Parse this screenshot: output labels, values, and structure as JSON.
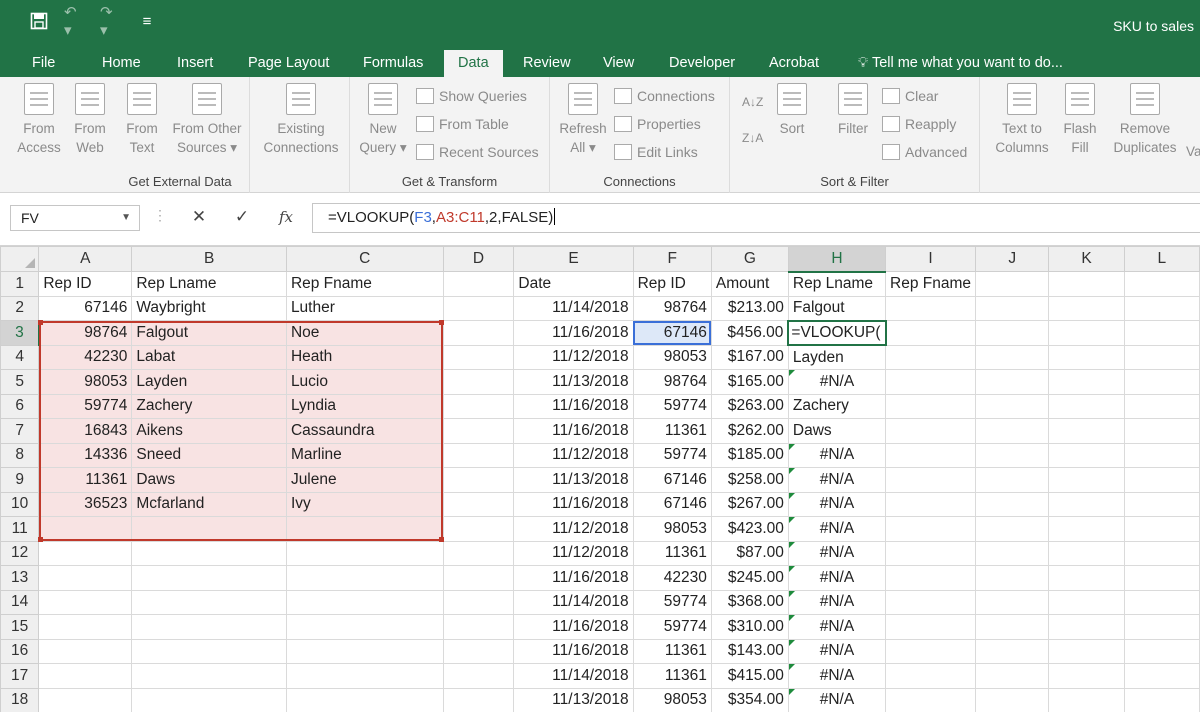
{
  "window": {
    "title": "SKU to sales",
    "qat": [
      "save-icon",
      "undo-icon",
      "redo-icon",
      "customize-icon"
    ]
  },
  "menu": {
    "tabs": [
      "File",
      "Home",
      "Insert",
      "Page Layout",
      "Formulas",
      "Data",
      "Review",
      "View",
      "Developer",
      "Acrobat"
    ],
    "active": "Data",
    "tell_me": "Tell me what you want to do..."
  },
  "ribbon": {
    "get_external": {
      "label": "Get External Data",
      "buttons": [
        "From\nAccess",
        "From\nWeb",
        "From\nText",
        "From Other\nSources ▾",
        "Existing\nConnections"
      ]
    },
    "transform": {
      "label": "Get & Transform",
      "new_query": "New\nQuery ▾",
      "items": [
        "Show Queries",
        "From Table",
        "Recent Sources"
      ]
    },
    "connections": {
      "label": "Connections",
      "refresh": "Refresh\nAll ▾",
      "items": [
        "Connections",
        "Properties",
        "Edit Links"
      ]
    },
    "sort_filter": {
      "label": "Sort & Filter",
      "sort": "Sort",
      "filter": "Filter",
      "items": [
        "Clear",
        "Reapply",
        "Advanced"
      ]
    },
    "data_tools": {
      "buttons": [
        "Text to\nColumns",
        "Flash\nFill",
        "Remove\nDuplicates",
        "Va"
      ]
    }
  },
  "formula_bar": {
    "name_box": "FV",
    "formula_prefix": "=VLOOKUP(",
    "formula_ref1": "F3",
    "formula_sep": ",",
    "formula_ref2": "A3:C11",
    "formula_suffix": ",2,FALSE)"
  },
  "grid": {
    "columns": [
      "A",
      "B",
      "C",
      "D",
      "E",
      "F",
      "G",
      "H",
      "I",
      "J",
      "K",
      "L"
    ],
    "selected_column": "H",
    "selected_row": 3,
    "rows": [
      [
        "Rep ID",
        "Rep Lname",
        "Rep Fname",
        "",
        "Date",
        "Rep ID",
        "Amount",
        "Rep Lname",
        "Rep Fname",
        "",
        "",
        ""
      ],
      [
        "67146",
        "Waybright",
        "Luther",
        "",
        "11/14/2018",
        "98764",
        "$213.00",
        "Falgout",
        "",
        "",
        "",
        ""
      ],
      [
        "98764",
        "Falgout",
        "Noe",
        "",
        "11/16/2018",
        "67146",
        "$456.00",
        "=VLOOKUP(",
        "",
        "",
        "",
        ""
      ],
      [
        "42230",
        "Labat",
        "Heath",
        "",
        "11/12/2018",
        "98053",
        "$167.00",
        "Layden",
        "",
        "",
        "",
        ""
      ],
      [
        "98053",
        "Layden",
        "Lucio",
        "",
        "11/13/2018",
        "98764",
        "$165.00",
        "#N/A",
        "",
        "",
        "",
        ""
      ],
      [
        "59774",
        "Zachery",
        "Lyndia",
        "",
        "11/16/2018",
        "59774",
        "$263.00",
        "Zachery",
        "",
        "",
        "",
        ""
      ],
      [
        "16843",
        "Aikens",
        "Cassaundra",
        "",
        "11/16/2018",
        "11361",
        "$262.00",
        "Daws",
        "",
        "",
        "",
        ""
      ],
      [
        "14336",
        "Sneed",
        "Marline",
        "",
        "11/12/2018",
        "59774",
        "$185.00",
        "#N/A",
        "",
        "",
        "",
        ""
      ],
      [
        "11361",
        "Daws",
        "Julene",
        "",
        "11/13/2018",
        "67146",
        "$258.00",
        "#N/A",
        "",
        "",
        "",
        ""
      ],
      [
        "36523",
        "Mcfarland",
        "Ivy",
        "",
        "11/16/2018",
        "67146",
        "$267.00",
        "#N/A",
        "",
        "",
        "",
        ""
      ],
      [
        "",
        "",
        "",
        "",
        "11/12/2018",
        "98053",
        "$423.00",
        "#N/A",
        "",
        "",
        "",
        ""
      ],
      [
        "",
        "",
        "",
        "",
        "11/12/2018",
        "11361",
        "$87.00",
        "#N/A",
        "",
        "",
        "",
        ""
      ],
      [
        "",
        "",
        "",
        "",
        "11/16/2018",
        "42230",
        "$245.00",
        "#N/A",
        "",
        "",
        "",
        ""
      ],
      [
        "",
        "",
        "",
        "",
        "11/14/2018",
        "59774",
        "$368.00",
        "#N/A",
        "",
        "",
        "",
        ""
      ],
      [
        "",
        "",
        "",
        "",
        "11/16/2018",
        "59774",
        "$310.00",
        "#N/A",
        "",
        "",
        "",
        ""
      ],
      [
        "",
        "",
        "",
        "",
        "11/16/2018",
        "11361",
        "$143.00",
        "#N/A",
        "",
        "",
        "",
        ""
      ],
      [
        "",
        "",
        "",
        "",
        "11/14/2018",
        "11361",
        "$415.00",
        "#N/A",
        "",
        "",
        "",
        ""
      ],
      [
        "",
        "",
        "",
        "",
        "11/13/2018",
        "98053",
        "$354.00",
        "#N/A",
        "",
        "",
        "",
        ""
      ]
    ]
  },
  "colors": {
    "excel_green": "#217346",
    "range_border": "#c0392b",
    "range_fill": "#f8e3e3",
    "ref_blue": "#3a6fd8"
  }
}
